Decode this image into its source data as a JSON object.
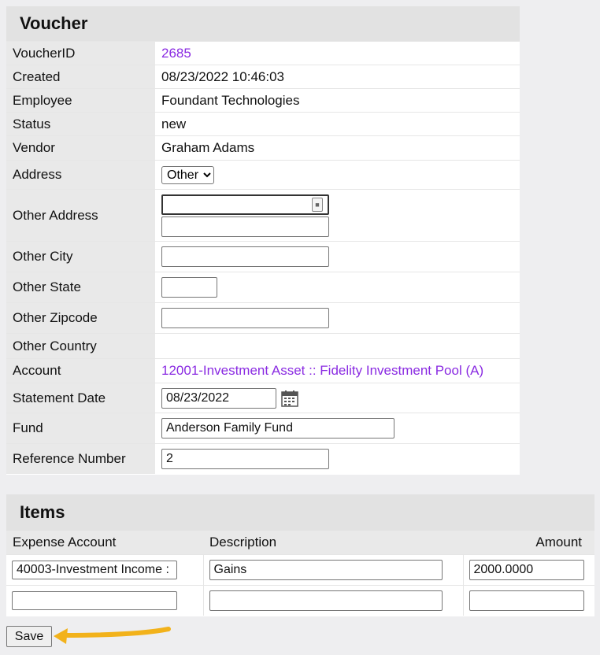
{
  "voucher": {
    "title": "Voucher",
    "labels": {
      "voucher_id": "VoucherID",
      "created": "Created",
      "employee": "Employee",
      "status": "Status",
      "vendor": "Vendor",
      "address": "Address",
      "other_address": "Other Address",
      "other_city": "Other City",
      "other_state": "Other State",
      "other_zipcode": "Other Zipcode",
      "other_country": "Other Country",
      "account": "Account",
      "statement_date": "Statement Date",
      "fund": "Fund",
      "reference_number": "Reference Number"
    },
    "values": {
      "voucher_id": "2685",
      "created": "08/23/2022 10:46:03",
      "employee": "Foundant Technologies",
      "status": "new",
      "vendor": "Graham Adams",
      "address_selected": "Other",
      "other_address_line1": "",
      "other_address_line2": "",
      "other_city": "",
      "other_state": "",
      "other_zipcode": "",
      "other_country": "",
      "account": "12001-Investment Asset :: Fidelity Investment Pool (A)",
      "statement_date": "08/23/2022",
      "fund": "Anderson Family Fund",
      "reference_number": "2"
    }
  },
  "items": {
    "title": "Items",
    "columns": {
      "expense_account": "Expense Account",
      "description": "Description",
      "amount": "Amount"
    },
    "rows": [
      {
        "expense_account": "40003-Investment Income :",
        "description": "Gains",
        "amount": "2000.0000"
      },
      {
        "expense_account": "",
        "description": "",
        "amount": ""
      }
    ]
  },
  "save_label": "Save",
  "colors": {
    "link": "#8a2be2",
    "header_bg": "#e2e2e2",
    "label_bg": "#e9e9e9",
    "arrow": "#f2b21b"
  }
}
